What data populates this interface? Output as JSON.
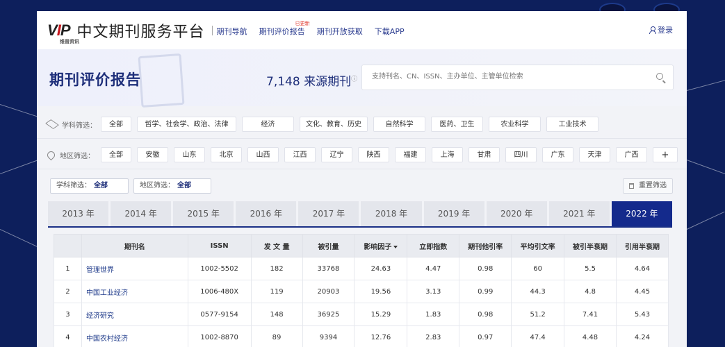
{
  "header": {
    "logo_text": "VIP",
    "logo_sub": "维普资讯",
    "site_title": "中文期刊服务平台",
    "nav": [
      {
        "label": "期刊导航"
      },
      {
        "label": "期刊评价报告",
        "badge": "已更新"
      },
      {
        "label": "期刊开放获取"
      },
      {
        "label": "下载APP"
      }
    ],
    "login": "登录"
  },
  "banner": {
    "title": "期刊评价报告",
    "count_value": "7,148",
    "count_label": "来源期刊",
    "info_icon": "ⓘ",
    "search_placeholder": "支持刊名、CN、ISSN、主办单位、主管单位检索"
  },
  "filters": {
    "subject_label": "学科筛选：",
    "subjects": [
      "全部",
      "哲学、社会学、政治、法律",
      "经济",
      "文化、教育、历史",
      "自然科学",
      "医药、卫生",
      "农业科学",
      "工业技术"
    ],
    "region_label": "地区筛选：",
    "regions": [
      "全部",
      "安徽",
      "山东",
      "北京",
      "山西",
      "江西",
      "辽宁",
      "陕西",
      "福建",
      "上海",
      "甘肃",
      "四川",
      "广东",
      "天津",
      "广西",
      "+"
    ]
  },
  "selection": {
    "subject_prefix": "学科筛选：",
    "subject_value": "全部",
    "region_prefix": "地区筛选：",
    "region_value": "全部",
    "reset": "重置筛选"
  },
  "years": [
    "2013 年",
    "2014 年",
    "2015 年",
    "2016 年",
    "2017 年",
    "2018 年",
    "2019 年",
    "2020 年",
    "2021 年",
    "2022 年"
  ],
  "active_year": "2022 年",
  "table": {
    "headers": [
      "",
      "期刊名",
      "ISSN",
      "发 文 量",
      "被引量",
      "影响因子",
      "立即指数",
      "期刊他引率",
      "平均引文率",
      "被引半衰期",
      "引用半衰期"
    ],
    "rows": [
      [
        "1",
        "管理世界",
        "1002-5502",
        "182",
        "33768",
        "24.63",
        "4.47",
        "0.98",
        "60",
        "5.5",
        "4.64"
      ],
      [
        "2",
        "中国工业经济",
        "1006-480X",
        "119",
        "20903",
        "19.56",
        "3.13",
        "0.99",
        "44.3",
        "4.8",
        "4.45"
      ],
      [
        "3",
        "经济研究",
        "0577-9154",
        "148",
        "36925",
        "15.29",
        "1.83",
        "0.98",
        "51.2",
        "7.41",
        "5.43"
      ],
      [
        "4",
        "中国农村经济",
        "1002-8870",
        "89",
        "9394",
        "12.76",
        "2.83",
        "0.97",
        "47.4",
        "4.48",
        "4.24"
      ]
    ]
  },
  "colors": {
    "brand": "#142a8c",
    "link": "#1e3a8a",
    "badge": "#e0362b",
    "logo_red": "#c8161d"
  }
}
